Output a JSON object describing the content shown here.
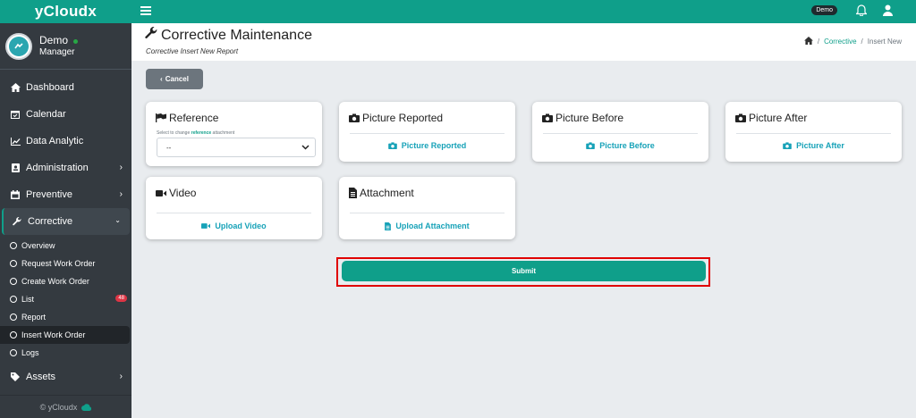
{
  "app": {
    "brand": "yCloudx",
    "footer": "© yCloudx"
  },
  "user": {
    "name": "Demo",
    "role": "Manager"
  },
  "topbar": {
    "demo_label": "Demo"
  },
  "sidebar": {
    "items": [
      {
        "label": "Dashboard",
        "icon": "home-icon"
      },
      {
        "label": "Calendar",
        "icon": "calendar-check-icon"
      },
      {
        "label": "Data Analytic",
        "icon": "chart-line-icon"
      },
      {
        "label": "Administration",
        "icon": "id-badge-icon"
      },
      {
        "label": "Preventive",
        "icon": "calendar-icon"
      },
      {
        "label": "Corrective",
        "icon": "wrench-icon"
      },
      {
        "label": "Assets",
        "icon": "tag-icon"
      }
    ],
    "sub_items": [
      {
        "label": "Overview"
      },
      {
        "label": "Request Work Order"
      },
      {
        "label": "Create Work Order"
      },
      {
        "label": "List",
        "badge": "48"
      },
      {
        "label": "Report"
      },
      {
        "label": "Insert Work Order"
      },
      {
        "label": "Logs"
      }
    ]
  },
  "header": {
    "title": "Corrective Maintenance",
    "subtitle": "Corrective Insert New Report",
    "breadcrumb": {
      "current_section": "Corrective",
      "page": "Insert New",
      "separator": "/"
    }
  },
  "actions": {
    "cancel": "Cancel",
    "submit": "Submit"
  },
  "cards": {
    "reference": {
      "title": "Reference",
      "hint_prefix": "Select to change",
      "hint_link": "reference",
      "hint_suffix": "attachment",
      "select_value": "--"
    },
    "picture_reported": {
      "title": "Picture Reported",
      "link": "Picture Reported"
    },
    "picture_before": {
      "title": "Picture Before",
      "link": "Picture Before"
    },
    "picture_after": {
      "title": "Picture After",
      "link": "Picture After"
    },
    "video": {
      "title": "Video",
      "link": "Upload Video"
    },
    "attachment": {
      "title": "Attachment",
      "link": "Upload Attachment"
    }
  },
  "colors": {
    "primary": "#0f9f8a",
    "sidebar": "#343a40",
    "link": "#17a2b8",
    "cancel": "#6c757d",
    "badge": "#dc3545",
    "highlight": "#e00000"
  }
}
